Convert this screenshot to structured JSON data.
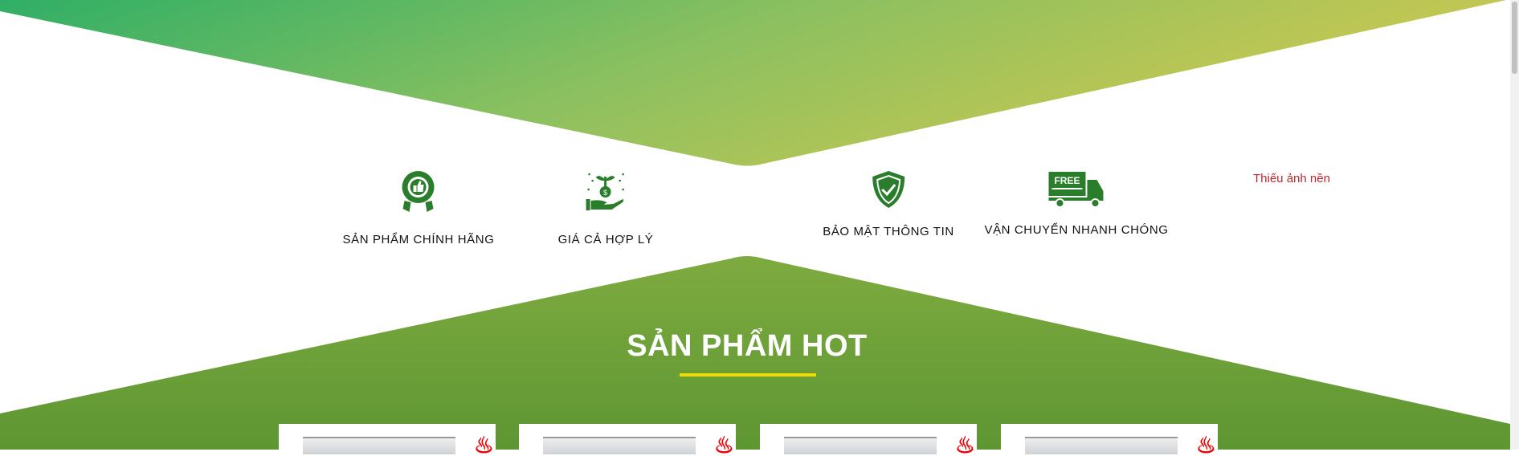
{
  "features": [
    {
      "label": "SẢN PHẨM CHÍNH HÃNG",
      "icon": "award-thumbs-up-icon"
    },
    {
      "label": "GIÁ CẢ HỢP LÝ",
      "icon": "money-plant-hand-icon"
    },
    {
      "label": "BẢO MẬT THÔNG TIN",
      "icon": "shield-check-icon"
    },
    {
      "label": "VẬN CHUYỂN NHANH CHÓNG",
      "icon": "free-delivery-truck-icon",
      "badge": "FREE"
    }
  ],
  "missing_background": "Thiếu ảnh nền",
  "section_title": "SẢN PHẨM HOT",
  "colors": {
    "icon": "#2a7d2a",
    "accent": "#f2dc00",
    "missing": "#c0272d"
  }
}
